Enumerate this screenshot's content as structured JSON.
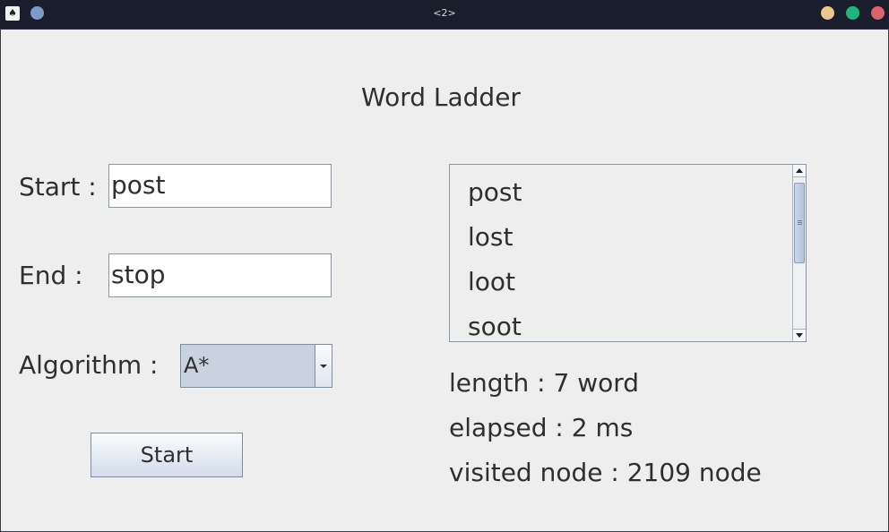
{
  "window": {
    "title": "<2>",
    "app_icon": "java-icon",
    "colors": {
      "titlebar": "#1a1d2b",
      "sticky": "#7a9cc7",
      "minimize": "#e8c98a",
      "maximize": "#20b47f",
      "close": "#d9646f"
    }
  },
  "form": {
    "heading": "Word Ladder",
    "start_label": "Start :",
    "start_value": "post",
    "end_label": "End :",
    "end_value": "stop",
    "algorithm_label": "Algorithm :",
    "algorithm_value": "A*",
    "start_button": "Start"
  },
  "results": {
    "path": [
      "post",
      "lost",
      "loot",
      "soot"
    ],
    "length": "length : 7 word",
    "elapsed": "elapsed : 2 ms",
    "visited": "visited node : 2109 node"
  }
}
